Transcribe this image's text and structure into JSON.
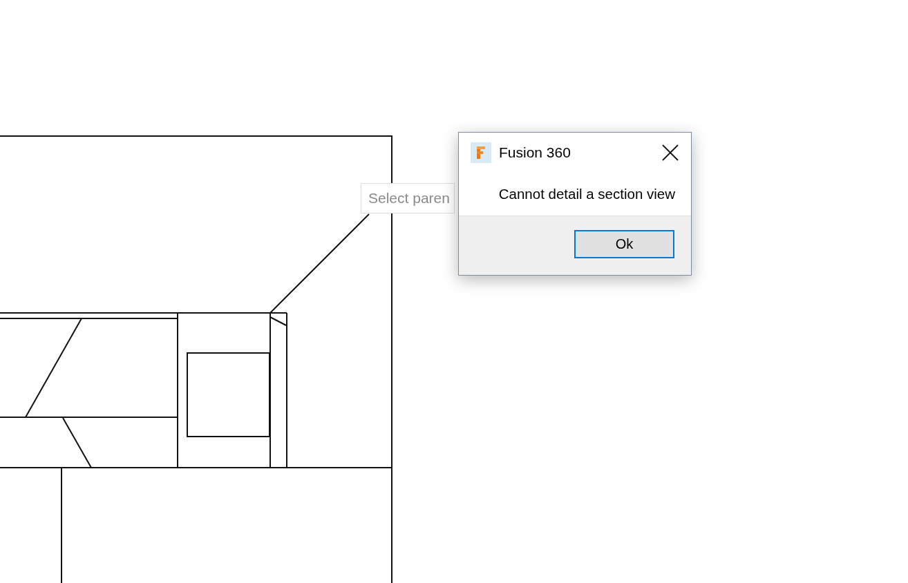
{
  "drawing_tooltip": {
    "text": "Select paren"
  },
  "dialog": {
    "title": "Fusion 360",
    "message": "Cannot detail a section view",
    "buttons": [
      {
        "label": "Ok",
        "focused": true
      }
    ]
  }
}
